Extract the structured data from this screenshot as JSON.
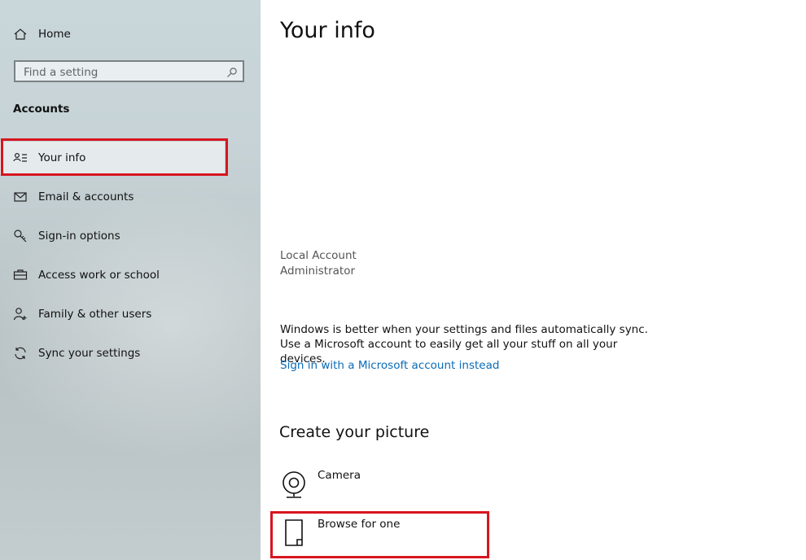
{
  "sidebar": {
    "home_label": "Home",
    "search_placeholder": "Find a setting",
    "section_title": "Accounts",
    "items": [
      {
        "label": "Your info",
        "icon": "person-card-icon"
      },
      {
        "label": "Email & accounts",
        "icon": "mail-icon"
      },
      {
        "label": "Sign-in options",
        "icon": "key-icon"
      },
      {
        "label": "Access work or school",
        "icon": "briefcase-icon"
      },
      {
        "label": "Family & other users",
        "icon": "person-add-icon"
      },
      {
        "label": "Sync your settings",
        "icon": "sync-icon"
      }
    ]
  },
  "main": {
    "title": "Your info",
    "account_type": "Local Account",
    "account_role": "Administrator",
    "sync_text": "Windows is better when your settings and files automatically sync. Use a Microsoft account to easily get all your stuff on all your devices.",
    "ms_link": "Sign in with a Microsoft account instead",
    "picture_title": "Create your picture",
    "options": [
      {
        "label": "Camera",
        "icon": "camera-icon"
      },
      {
        "label": "Browse for one",
        "icon": "file-icon"
      }
    ]
  },
  "colors": {
    "highlight": "#d7151f",
    "link": "#0a6cb8"
  }
}
